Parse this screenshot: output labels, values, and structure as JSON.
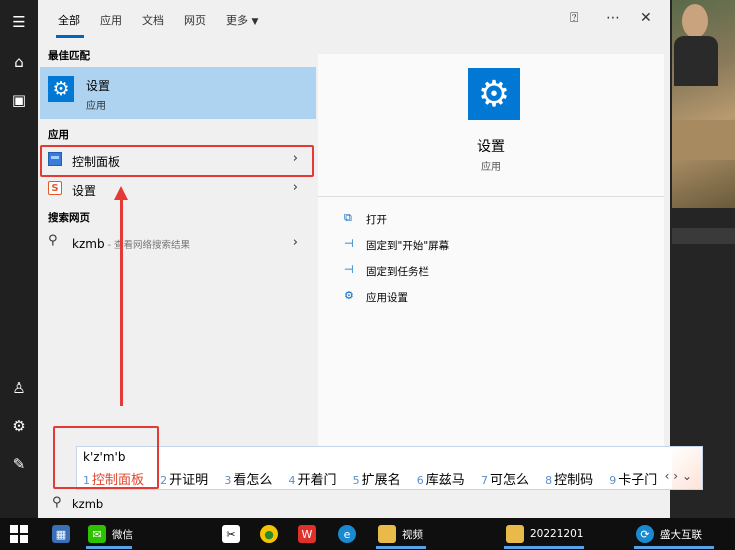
{
  "tabs": [
    "全部",
    "应用",
    "文档",
    "网页",
    "更多"
  ],
  "sections": {
    "best_match": "最佳匹配",
    "apps": "应用",
    "web": "搜索网页"
  },
  "best_match": {
    "title": "设置",
    "subtitle": "应用"
  },
  "apps": [
    {
      "label": "控制面板",
      "icon": "control-panel-icon"
    },
    {
      "label": "设置",
      "icon": "settings-app-icon"
    }
  ],
  "web": {
    "query": "kzmb",
    "suffix": " - 查看网络搜索结果"
  },
  "detail": {
    "title": "设置",
    "subtitle": "应用",
    "actions": [
      {
        "label": "打开",
        "icon": "open-icon"
      },
      {
        "label": "固定到\"开始\"屏幕",
        "icon": "pin-start-icon"
      },
      {
        "label": "固定到任务栏",
        "icon": "pin-taskbar-icon"
      },
      {
        "label": "应用设置",
        "icon": "gear-icon"
      }
    ]
  },
  "ime": {
    "composition": "k'z'm'b",
    "candidates": [
      {
        "num": "1",
        "text": "控制面板"
      },
      {
        "num": "2",
        "text": "开证明"
      },
      {
        "num": "3",
        "text": "看怎么"
      },
      {
        "num": "4",
        "text": "开着门"
      },
      {
        "num": "5",
        "text": "扩展名"
      },
      {
        "num": "6",
        "text": "库兹马"
      },
      {
        "num": "7",
        "text": "可怎么"
      },
      {
        "num": "8",
        "text": "控制码"
      },
      {
        "num": "9",
        "text": "卡子门"
      }
    ]
  },
  "search": {
    "value": "kzmb"
  },
  "taskbar": [
    {
      "label": "微信",
      "icon": "wechat-icon"
    },
    {
      "label": "视频",
      "icon": "folder-icon"
    },
    {
      "label": "20221201",
      "icon": "folder-icon"
    },
    {
      "label": "盛大互联",
      "icon": "app-icon"
    }
  ],
  "colors": {
    "accent": "#0078d4",
    "highlight": "#aed3f1",
    "annotation": "#e53935"
  }
}
